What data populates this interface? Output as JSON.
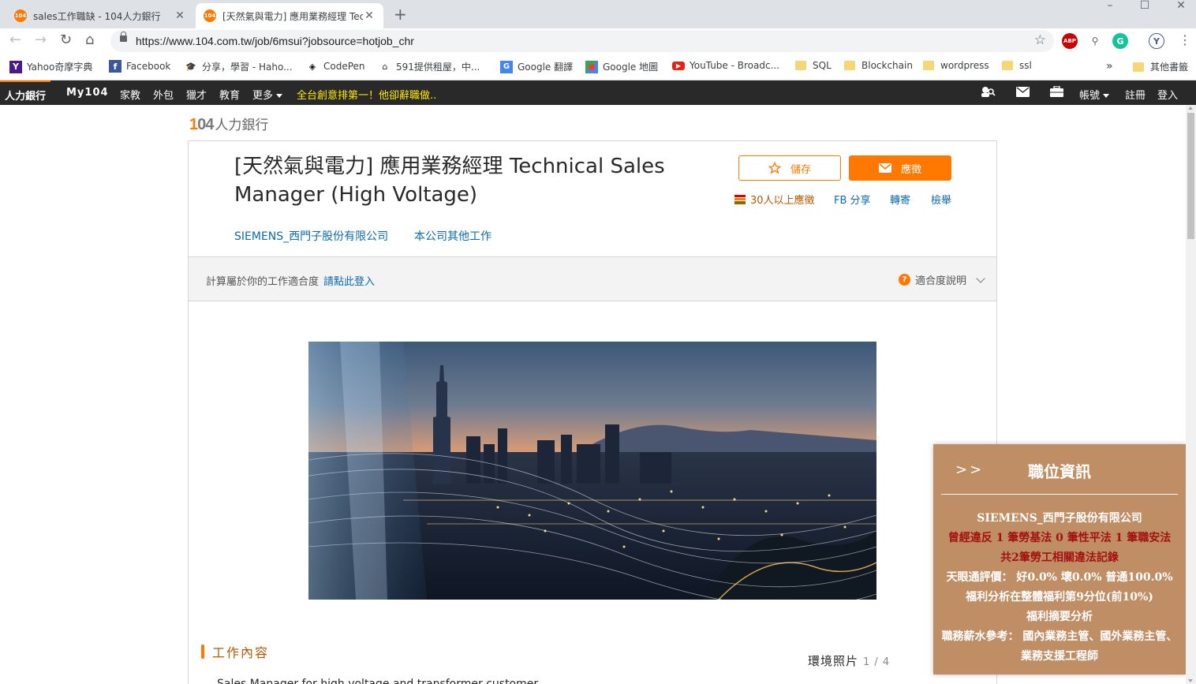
{
  "browser": {
    "tabs": [
      {
        "favicon": "104",
        "title": "sales工作職缺 - 104人力銀行",
        "active": false
      },
      {
        "favicon": "104",
        "title": "[天然氣與電力] 應用業務經理 Technical Sales Manager",
        "active": true
      }
    ],
    "url": "https://www.104.com.tw/job/6msui?jobsource=hotjob_chr",
    "profile_initial": "Y",
    "bookmarks": [
      "Yahoo奇摩字典",
      "Facebook",
      "分享，學習 - Haho...",
      "CodePen",
      "591提供租屋，中...",
      "Google 翻譯",
      "Google 地圖",
      "YouTube - Broadc...",
      "SQL",
      "Blockchain",
      "wordpress",
      "ssl"
    ],
    "bookmarks_overflow": "»",
    "other_bookmarks": "其他書籤"
  },
  "site_nav": {
    "brand": "人力銀行",
    "items": [
      "My104",
      "家教",
      "外包",
      "獵才",
      "教育",
      "更多"
    ],
    "promo": "全台創意排第一！他卻辭職做..",
    "right": {
      "account": "帳號",
      "register": "註冊",
      "login": "登入"
    }
  },
  "logo": {
    "number": "104",
    "text": "人力銀行"
  },
  "job": {
    "title": "[天然氣與電力] 應用業務經理 Technical Sales Manager (High Voltage)",
    "company": "SIEMENS_西門子股份有限公司",
    "other_jobs": "本公司其他工作",
    "save_label": "儲存",
    "apply_label": "應徵",
    "applicants": "30人以上應徵",
    "fb_share": "FB 分享",
    "forward": "轉寄",
    "report": "檢舉"
  },
  "fitness": {
    "text": "計算屬於你的工作適合度",
    "login_link": "請點此登入",
    "help": "適合度說明"
  },
  "sections": {
    "job_content": "工作內容",
    "photos": "環境照片",
    "photo_counter": "1 / 4",
    "description_peek": "Sales Manager for high voltage and transformer customer"
  },
  "info_panel": {
    "toggle": ">>",
    "title": "職位資訊",
    "company": "SIEMENS_西門子股份有限公司",
    "violations": "曾經違反 1 筆勞基法 0 筆性平法 1 筆職安法",
    "violations_total": "共2筆勞工相關違法記錄",
    "rating": "天眼通評價： 好0.0% 壞0.0% 普通100.0%",
    "welfare_rank": "福利分析在整體福利第9分位(前10%)",
    "welfare_summary": "福利摘要分析",
    "salary_ref": "職務薪水參考： 國內業務主管、國外業務主管、業務支援工程師"
  },
  "colors": {
    "brand_orange": "#ff7800",
    "link_blue": "#0b6baf",
    "panel_brown": "#c08e65",
    "violation_red": "#a31212",
    "promo_yellow": "#ffea00"
  }
}
